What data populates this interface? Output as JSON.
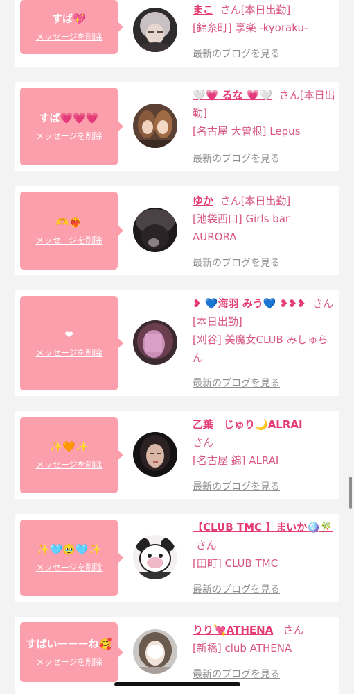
{
  "delete_label": "メッセージを削除",
  "blog_label": "最新のブログを見る",
  "san_suffix": "さん",
  "colors": {
    "background": "#f3f3f3",
    "bubble": "#fc9fad",
    "name": "#e53d72",
    "text_pink": "#d85683",
    "link_gray": "#8f8f8f"
  },
  "entries": [
    {
      "message": "すば💖",
      "name": "まこ",
      "status": "[本日出勤]",
      "shop": "[錦糸町] 享楽 -kyoraku-",
      "avatar_icon": "user-photo-icon"
    },
    {
      "message": "すば💗💗💗",
      "name": "🤍💗 るな 💗🤍",
      "status": "[本日出勤]",
      "shop": "[名古屋 大曽根] Lepus",
      "avatar_icon": "user-photo-icon"
    },
    {
      "message": "🫶❤️‍🔥",
      "name": "ゆか",
      "status": "[本日出勤]",
      "shop": "[池袋西口] Girls bar AURORA",
      "avatar_icon": "user-photo-icon"
    },
    {
      "message": "❤︎",
      "name": "❥ 💙海羽 みう💙 ❥❥❥",
      "status": "[本日出勤]",
      "shop": "[刈谷] 美魔女CLUB みしゅらん",
      "avatar_icon": "user-photo-icon"
    },
    {
      "message": "✨🧡✨",
      "name": "乙葉　じゅり🌙ALRAI",
      "status": "",
      "shop": "[名古屋 錦] ALRAI",
      "avatar_icon": "user-photo-icon"
    },
    {
      "message": "✨🩵🥹🩵✨",
      "name": "【CLUB TMC 】まいか🪩🎋",
      "status": "",
      "shop": "[田町] CLUB TMC",
      "avatar_icon": "user-photo-icon"
    },
    {
      "message": "すばいーーーね🥰",
      "name": "りり💘ATHENA",
      "status": "",
      "shop": "[新橋] club ATHENA",
      "avatar_icon": "user-photo-icon"
    }
  ]
}
